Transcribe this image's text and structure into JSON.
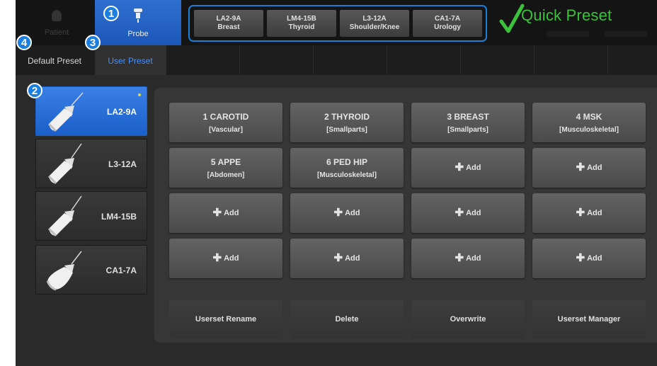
{
  "top_tabs": {
    "patient": "Patient",
    "probe": "Probe"
  },
  "quick_presets": [
    {
      "probe": "LA2-9A",
      "preset": "Breast"
    },
    {
      "probe": "LM4-15B",
      "preset": "Thyroid"
    },
    {
      "probe": "L3-12A",
      "preset": "Shoulder/Knee"
    },
    {
      "probe": "CA1-7A",
      "preset": "Urology"
    }
  ],
  "quick_preset_label": "Quick Preset",
  "sub_tabs": {
    "default": "Default Preset",
    "user": "User Preset"
  },
  "probes": [
    {
      "name": "LA2-9A",
      "selected": true
    },
    {
      "name": "L3-12A",
      "selected": false
    },
    {
      "name": "LM4-15B",
      "selected": false
    },
    {
      "name": "CA1-7A",
      "selected": false
    }
  ],
  "presets": [
    {
      "title": "1 CAROTID",
      "category": "[Vascular]"
    },
    {
      "title": "2 THYROID",
      "category": "[Smallparts]"
    },
    {
      "title": "3 BREAST",
      "category": "[Smallparts]"
    },
    {
      "title": "4 MSK",
      "category": "[Musculoskeletal]"
    },
    {
      "title": "5 APPE",
      "category": "[Abdomen]"
    },
    {
      "title": "6 PED HIP",
      "category": "[Musculoskeletal]"
    }
  ],
  "add_label": "Add",
  "add_slot_count": 10,
  "actions": {
    "rename": "Userset Rename",
    "delete": "Delete",
    "overwrite": "Overwrite",
    "manager": "Userset Manager"
  },
  "badges": {
    "one": "1",
    "two": "2",
    "three": "3",
    "four": "4"
  },
  "colors": {
    "accent": "#1a7fe0",
    "quick_preset": "#3cc13c",
    "selected_probe": "#2a6fd8",
    "user_preset_tab": "#4d8ff0"
  }
}
